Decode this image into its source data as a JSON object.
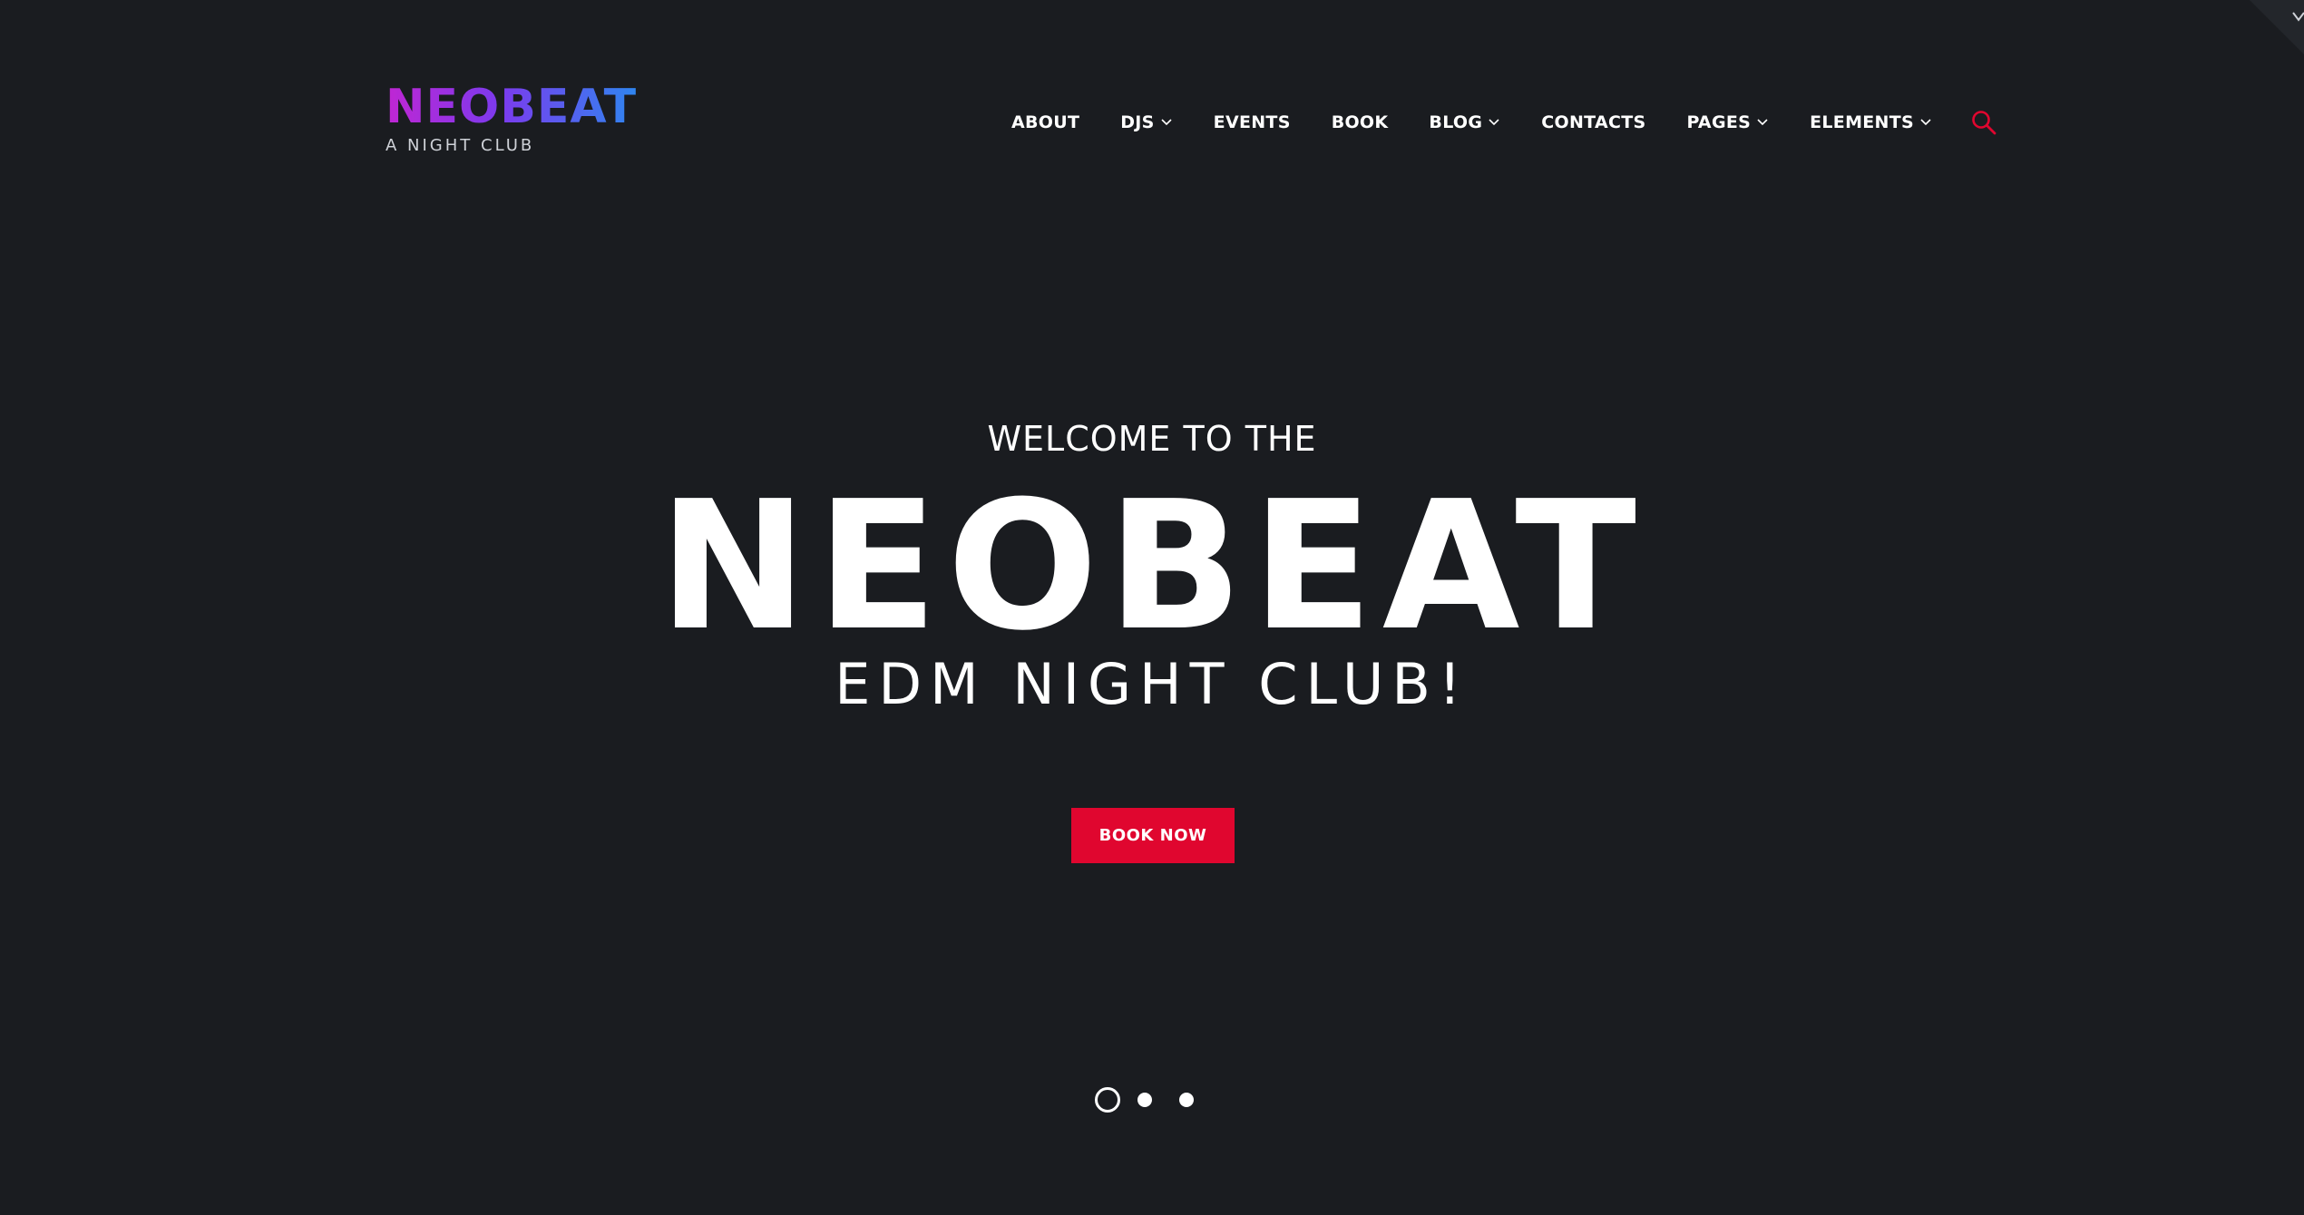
{
  "logo": {
    "title": "NEOBEAT",
    "subtitle": "A NIGHT CLUB"
  },
  "nav": {
    "items": [
      {
        "label": "ABOUT",
        "dropdown": false
      },
      {
        "label": "DJS",
        "dropdown": true
      },
      {
        "label": "EVENTS",
        "dropdown": false
      },
      {
        "label": "BOOK",
        "dropdown": false
      },
      {
        "label": "BLOG",
        "dropdown": true
      },
      {
        "label": "CONTACTS",
        "dropdown": false
      },
      {
        "label": "PAGES",
        "dropdown": true
      },
      {
        "label": "ELEMENTS",
        "dropdown": true
      }
    ],
    "search_icon": "search-icon"
  },
  "hero": {
    "welcome": "WELCOME TO THE",
    "title": "NEOBEAT",
    "subtitle": "EDM NIGHT CLUB!",
    "button_label": "BOOK NOW"
  },
  "slider": {
    "total": 3,
    "active_index": 0
  },
  "colors": {
    "background": "#1a1c20",
    "accent": "#e0062f",
    "logo_gradient": [
      "#c026d3",
      "#7c3aed",
      "#2f86f0"
    ],
    "text": "#ffffff"
  }
}
